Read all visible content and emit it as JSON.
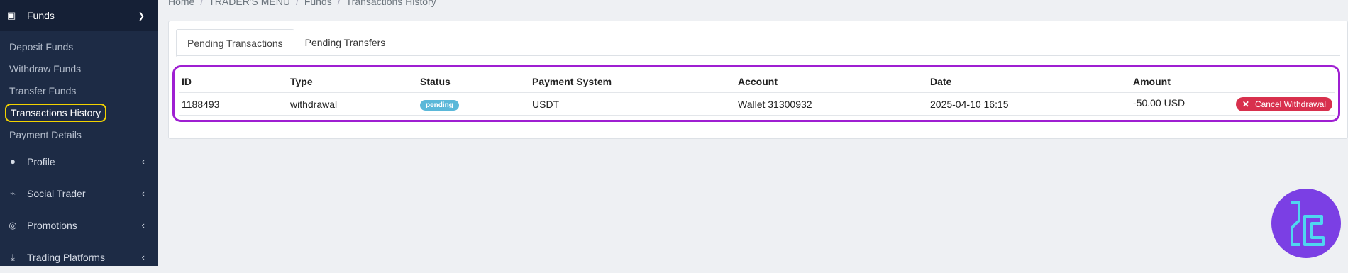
{
  "sidebar": {
    "section": {
      "label": "Funds",
      "icon": "wallet-icon"
    },
    "subitems": [
      {
        "label": "Deposit Funds"
      },
      {
        "label": "Withdraw Funds"
      },
      {
        "label": "Transfer Funds"
      },
      {
        "label": "Transactions History",
        "active": true
      },
      {
        "label": "Payment Details"
      }
    ],
    "items": [
      {
        "label": "Profile",
        "icon": "user-icon"
      },
      {
        "label": "Social Trader",
        "icon": "chart-icon"
      },
      {
        "label": "Promotions",
        "icon": "globe-icon"
      },
      {
        "label": "Trading Platforms",
        "icon": "download-icon"
      }
    ]
  },
  "breadcrumb": [
    "Home",
    "TRADER'S MENU",
    "Funds",
    "Transactions History"
  ],
  "tabs": [
    {
      "label": "Pending Transactions",
      "active": true
    },
    {
      "label": "Pending Transfers"
    }
  ],
  "table": {
    "headers": [
      "ID",
      "Type",
      "Status",
      "Payment System",
      "Account",
      "Date",
      "Amount"
    ],
    "rows": [
      {
        "id": "1188493",
        "type": "withdrawal",
        "status": "pending",
        "payment_system": "USDT",
        "account": "Wallet 31300932",
        "date": "2025-04-10 16:15",
        "amount": "-50.00 USD",
        "action": "Cancel Withdrawal"
      }
    ]
  },
  "colors": {
    "sidebar": "#1d2b45",
    "highlight_yellow": "#f2d200",
    "highlight_purple": "#9f1fd2",
    "badge": "#5bb8d9",
    "cancel": "#d8304d",
    "logo_bg": "#7b3fe4",
    "logo_stroke": "#4fd6f0"
  }
}
